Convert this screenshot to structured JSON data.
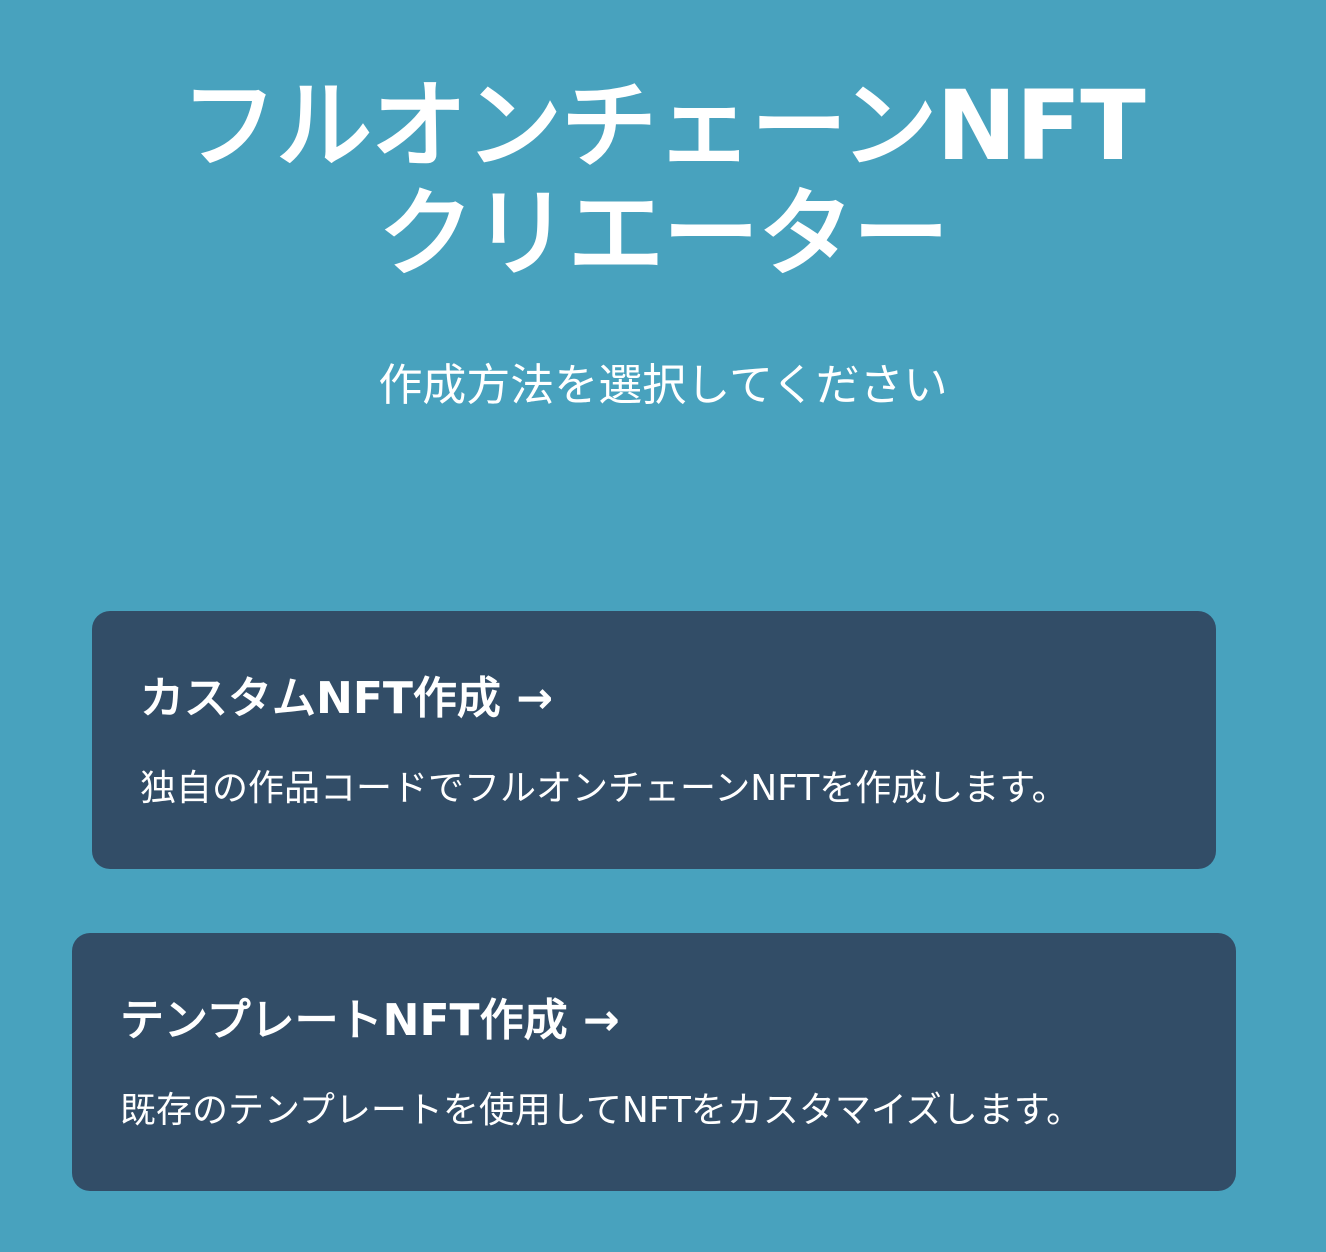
{
  "header": {
    "title_line1": "フルオンチェーンNFT",
    "title_line2": "クリエーター",
    "subtitle": "作成方法を選択してください"
  },
  "options": [
    {
      "title": "カスタムNFT作成 →",
      "description": "独自の作品コードでフルオンチェーンNFTを作成します。"
    },
    {
      "title": "テンプレートNFT作成 →",
      "description": "既存のテンプレートを使用してNFTをカスタマイズします。"
    }
  ],
  "colors": {
    "background": "#48a2be",
    "card": "#324d67",
    "text": "#ffffff"
  }
}
